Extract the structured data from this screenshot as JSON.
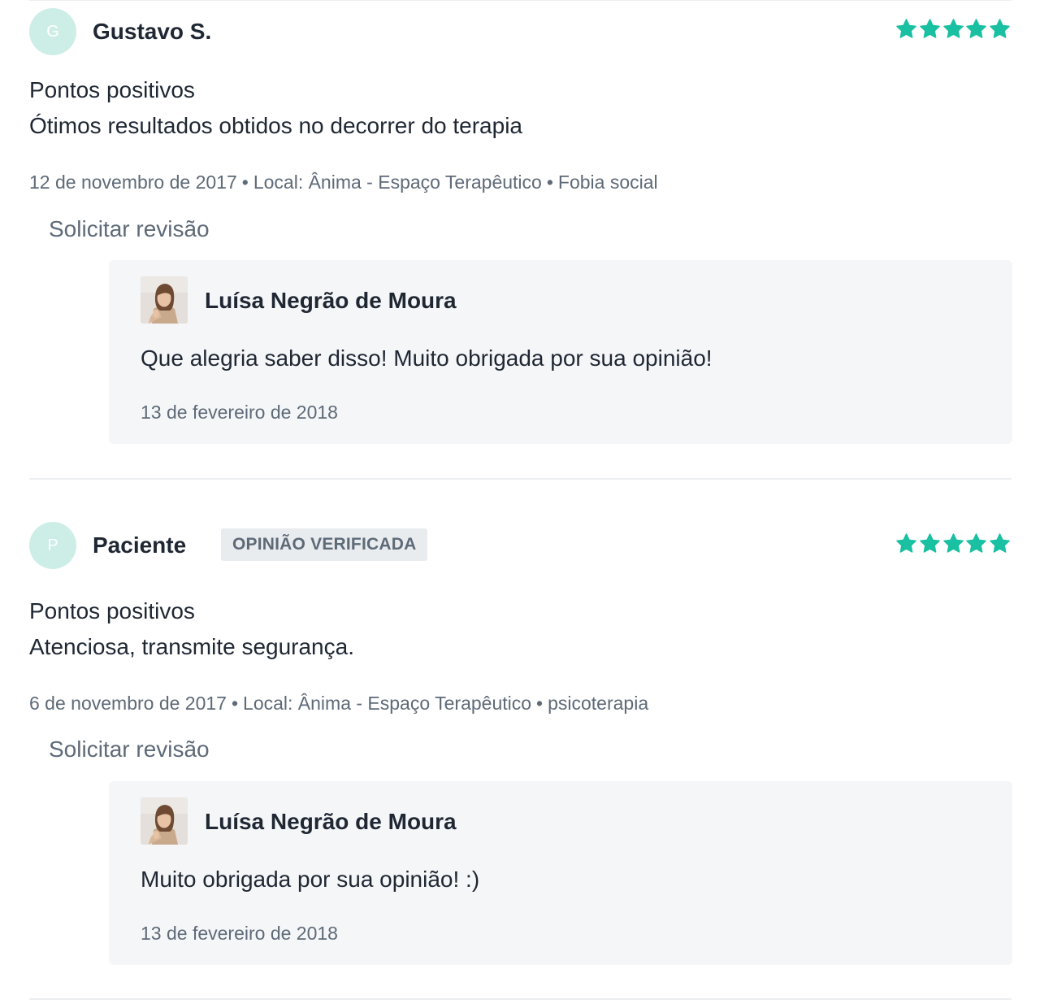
{
  "colors": {
    "star": "#19c0a1",
    "avatar_bg": "#cdeee6",
    "text_primary": "#1f2733",
    "text_secondary": "#5e6a78",
    "reply_bg": "#f5f6f8",
    "badge_bg": "#e9ecef"
  },
  "reviews": [
    {
      "avatar_initial": "G",
      "author": "Gustavo S.",
      "rating": 5,
      "section_title": "Pontos positivos",
      "comment": "Ótimos resultados obtidos no decorrer do terapia",
      "date": "12 de novembro de 2017",
      "location": "Local: Ânima - Espaço Terapêutico",
      "service": "Fobia social",
      "request_review_label": "Solicitar revisão",
      "reply": {
        "author": "Luísa Negrão de Moura",
        "photo_icon": "doctor-photo",
        "text": "Que alegria saber disso! Muito obrigada por sua opinião!",
        "date": "13 de fevereiro de 2018"
      }
    },
    {
      "avatar_initial": "P",
      "author": "Paciente",
      "badge": "OPINIÃO VERIFICADA",
      "rating": 5,
      "section_title": "Pontos positivos",
      "comment": "Atenciosa, transmite segurança.",
      "date": "6 de novembro de 2017",
      "location": "Local: Ânima - Espaço Terapêutico",
      "service": "psicoterapia",
      "request_review_label": "Solicitar revisão",
      "reply": {
        "author": "Luísa Negrão de Moura",
        "photo_icon": "doctor-photo",
        "text": "Muito obrigada por sua opinião! :)",
        "date": "13 de fevereiro de 2018"
      }
    }
  ],
  "meta_separator": "•"
}
